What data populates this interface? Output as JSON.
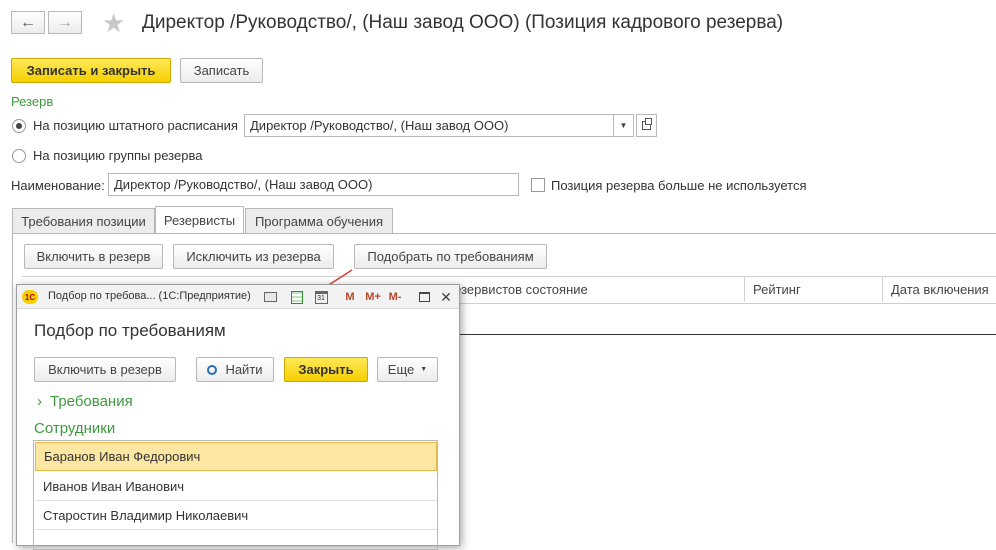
{
  "header": {
    "title": "Директор /Руководство/, (Наш завод ООО) (Позиция кадрового резерва)"
  },
  "toolbar": {
    "save_close_label": "Записать и закрыть",
    "save_label": "Записать"
  },
  "reserve": {
    "section_label": "Резерв",
    "radio_position_label": "На позицию штатного расписания",
    "radio_group_label": "На позицию группы резерва",
    "position_value": "Директор /Руководство/, (Наш завод ООО)",
    "name_label": "Наименование:",
    "name_value": "Директор /Руководство/, (Наш завод ООО)",
    "not_used_label": "Позиция резерва больше не используется"
  },
  "tabs": [
    {
      "label": "Требования позиции"
    },
    {
      "label": "Резервисты"
    },
    {
      "label": "Программа обучения"
    }
  ],
  "reservists": {
    "include_label": "Включить в резерв",
    "exclude_label": "Исключить из резерва",
    "select_label": "Подобрать по требованиям",
    "columns": {
      "state": "...х резервистов состояние",
      "rating": "Рейтинг",
      "date": "Дата включения"
    }
  },
  "popup": {
    "window_title": "Подбор по требова... (1С:Предприятие)",
    "heading": "Подбор по требованиям",
    "include_label": "Включить в резерв",
    "find_label": "Найти",
    "close_label": "Закрыть",
    "more_label": "Еще",
    "requirements_label": "Требования",
    "employees_label": "Сотрудники",
    "toolbar_m": "M",
    "toolbar_mplus": "M+",
    "toolbar_mminus": "M-",
    "calendar_day": "31",
    "logo_text": "1С",
    "employees": [
      {
        "name": "Баранов Иван Федорович"
      },
      {
        "name": "Иванов Иван Иванович"
      },
      {
        "name": "Старостин Владимир Николаевич"
      }
    ]
  },
  "colors": {
    "accent_yellow": "#f5cf00",
    "green_label": "#3d9a3d",
    "annotation_arrow": "#d9443a"
  }
}
